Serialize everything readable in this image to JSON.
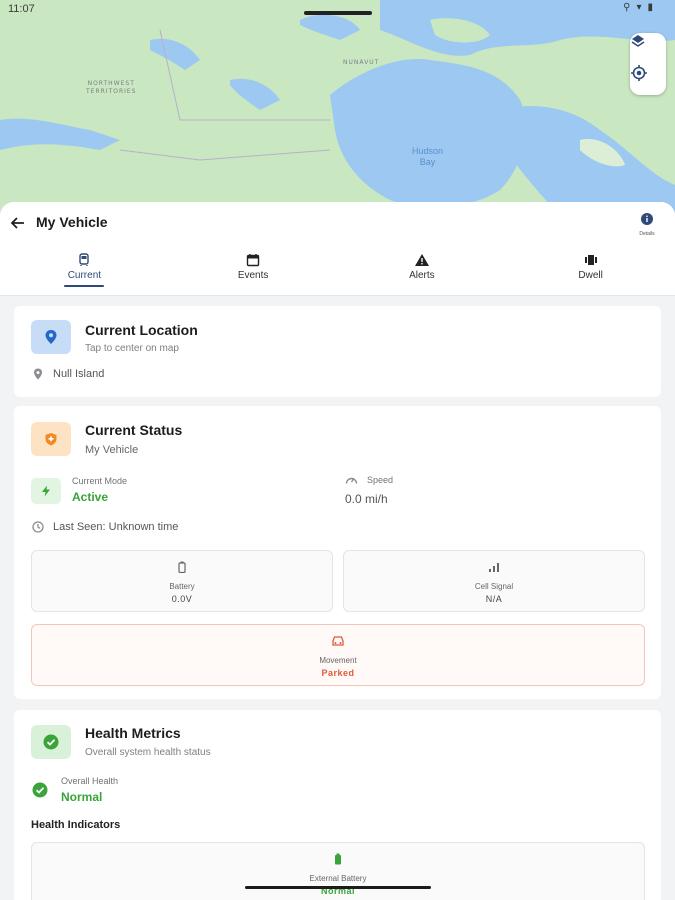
{
  "status_bar": {
    "time": "11:07"
  },
  "map": {
    "labels": {
      "nwt": "NORTHWEST\nTERRITORIES",
      "nunavut": "NUNAVUT",
      "hudson_bay": "Hudson\nBay"
    },
    "land_color": "#c9e7c1",
    "water_color": "#9cc8f2"
  },
  "header": {
    "title": "My Vehicle",
    "details_label": "Details"
  },
  "tabs": [
    {
      "label": "Current",
      "icon": "vehicle-icon",
      "active": true
    },
    {
      "label": "Events",
      "icon": "calendar-icon",
      "active": false
    },
    {
      "label": "Alerts",
      "icon": "warning-icon",
      "active": false
    },
    {
      "label": "Dwell",
      "icon": "dwell-icon",
      "active": false
    }
  ],
  "location_card": {
    "title": "Current Location",
    "subtitle": "Tap to center on map",
    "place": "Null Island"
  },
  "status_card": {
    "title": "Current Status",
    "subtitle": "My Vehicle",
    "mode_label": "Current Mode",
    "mode_value": "Active",
    "speed_label": "Speed",
    "speed_value": "0.0 mi/h",
    "last_seen": "Last Seen: Unknown time",
    "battery_label": "Battery",
    "battery_value": "0.0V",
    "cell_label": "Cell Signal",
    "cell_value": "N/A",
    "movement_label": "Movement",
    "movement_value": "Parked"
  },
  "health_card": {
    "title": "Health Metrics",
    "subtitle": "Overall system health status",
    "overall_label": "Overall Health",
    "overall_value": "Normal",
    "indicators_heading": "Health Indicators",
    "ext_battery_label": "External Battery",
    "ext_battery_value": "Normal"
  },
  "colors": {
    "accent": "#2f4a78",
    "green": "#3aa33a",
    "orange": "#e2593a",
    "location_icon_bg": "#c7dcf7",
    "status_icon_bg": "#fde3c4",
    "health_icon_bg": "#d9f1d9"
  }
}
